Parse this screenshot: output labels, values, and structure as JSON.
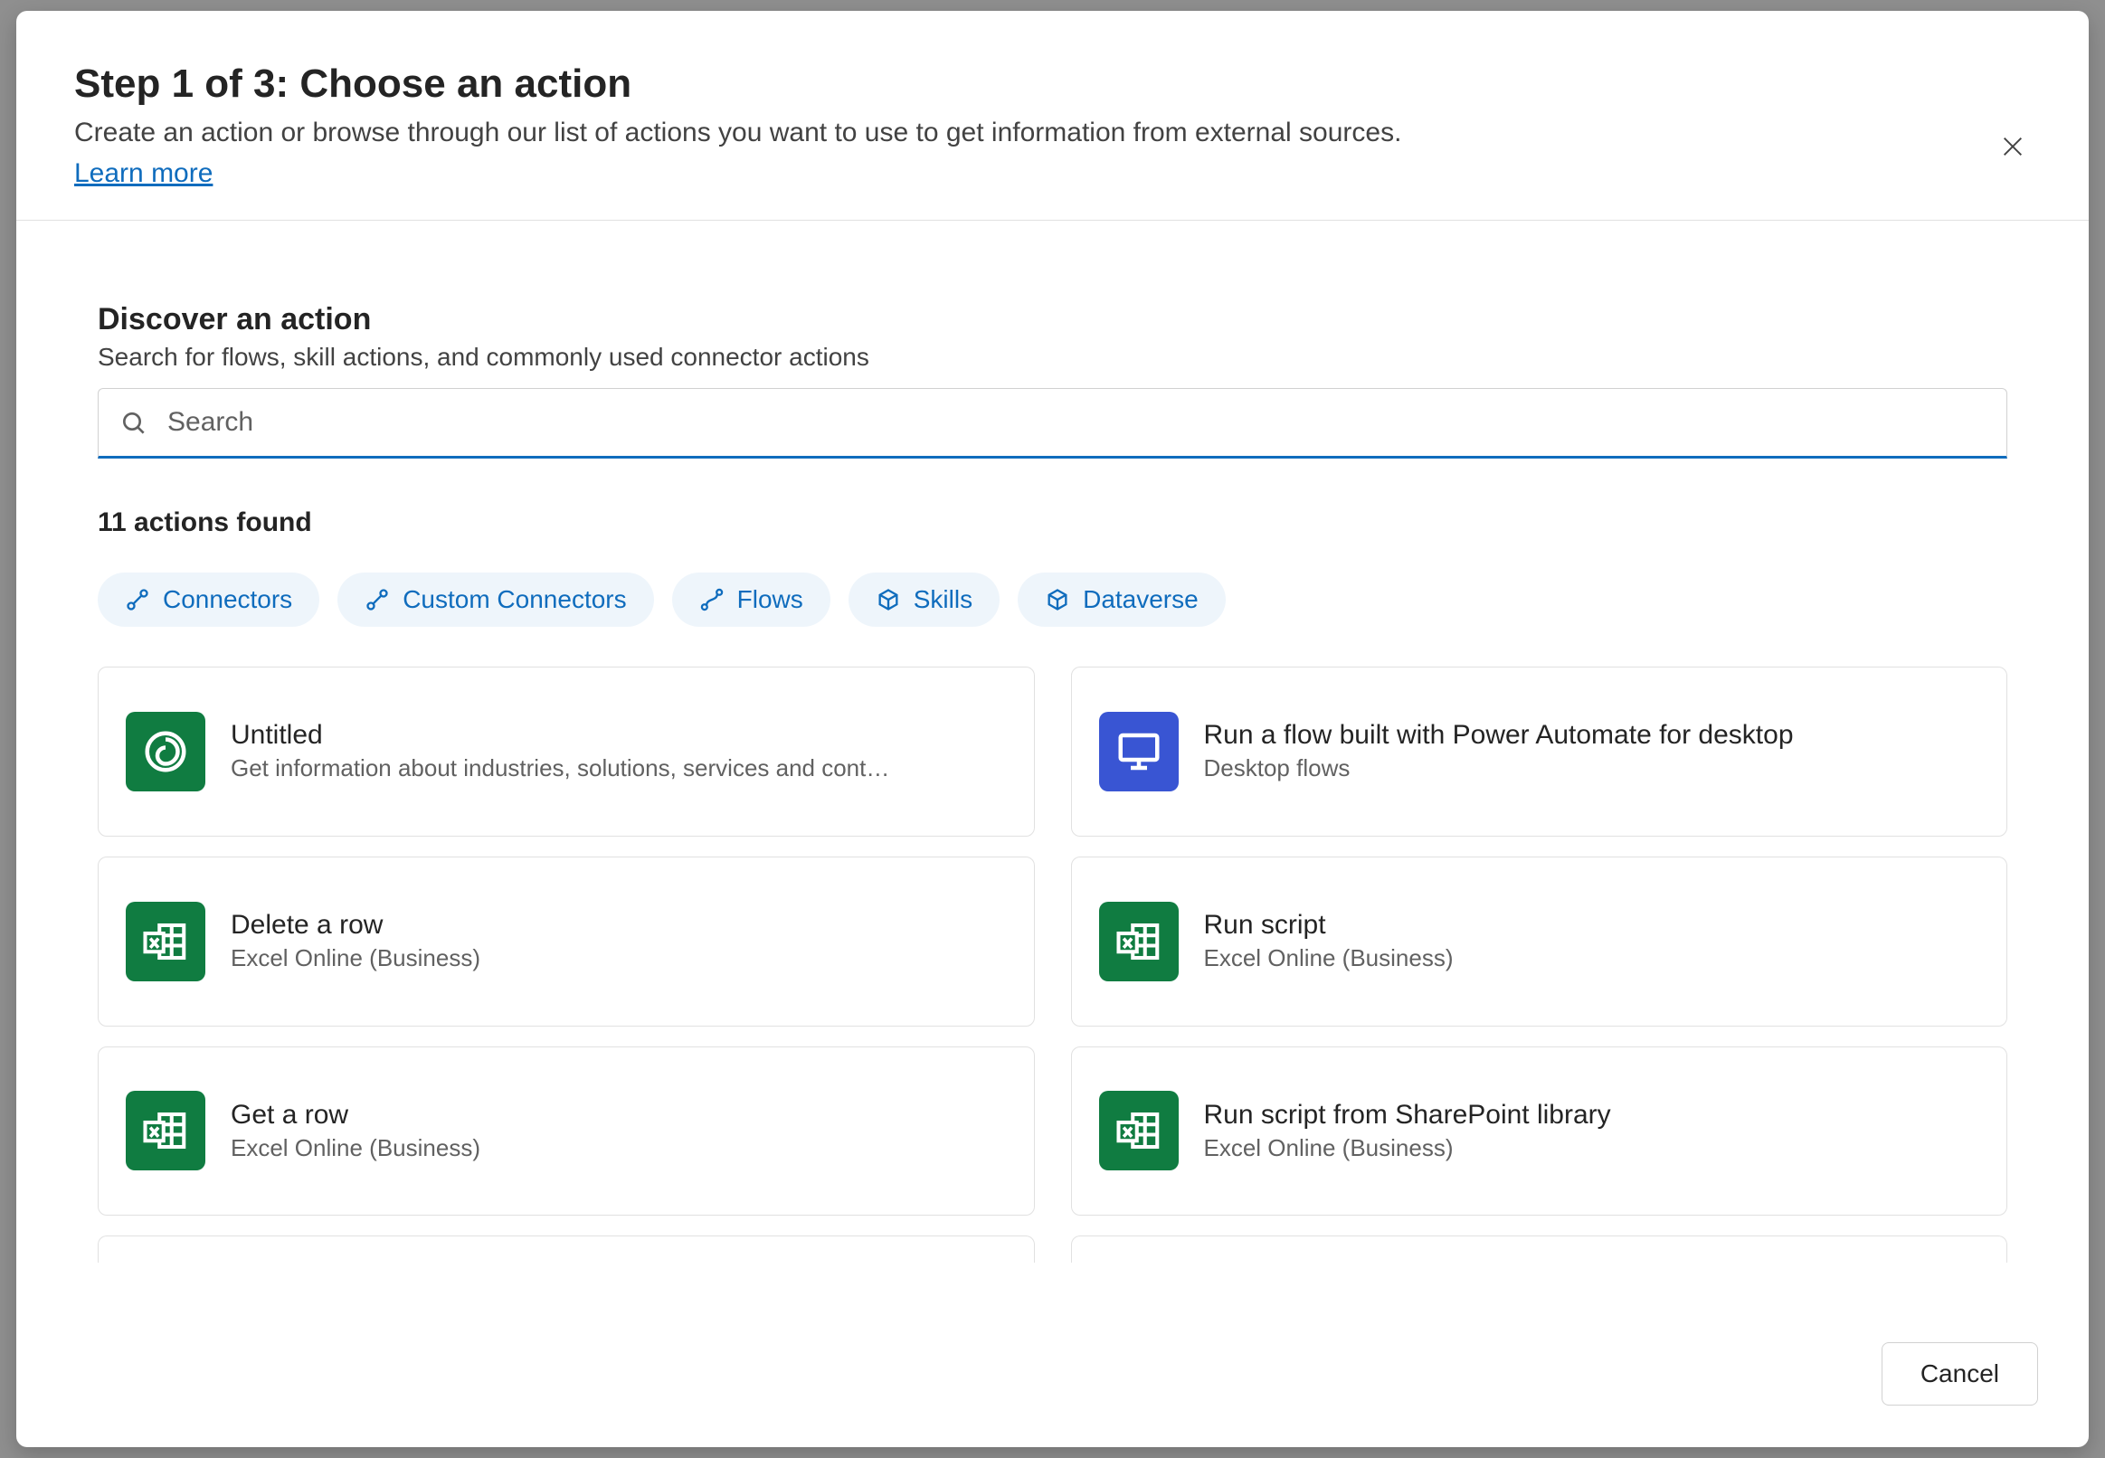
{
  "header": {
    "title": "Step 1 of 3: Choose an action",
    "subtitle": "Create an action or browse through our list of actions you want to use to get information from external sources.",
    "learn_more": "Learn more"
  },
  "discover": {
    "title": "Discover an action",
    "subtitle": "Search for flows, skill actions, and commonly used connector actions"
  },
  "search": {
    "placeholder": "Search",
    "value": ""
  },
  "results_count": "11 actions found",
  "filters": [
    {
      "label": "Connectors",
      "icon": "plug"
    },
    {
      "label": "Custom Connectors",
      "icon": "plug"
    },
    {
      "label": "Flows",
      "icon": "flow"
    },
    {
      "label": "Skills",
      "icon": "cube"
    },
    {
      "label": "Dataverse",
      "icon": "cube"
    }
  ],
  "actions": [
    {
      "title": "Untitled",
      "subtitle": "Get information about industries, solutions, services and cont…",
      "icon": "swirl",
      "icon_color": "green"
    },
    {
      "title": "Run a flow built with Power Automate for desktop",
      "subtitle": "Desktop flows",
      "icon": "desktop",
      "icon_color": "blue"
    },
    {
      "title": "Delete a row",
      "subtitle": "Excel Online (Business)",
      "icon": "excel",
      "icon_color": "green"
    },
    {
      "title": "Run script",
      "subtitle": "Excel Online (Business)",
      "icon": "excel",
      "icon_color": "green"
    },
    {
      "title": "Get a row",
      "subtitle": "Excel Online (Business)",
      "icon": "excel",
      "icon_color": "green"
    },
    {
      "title": "Run script from SharePoint library",
      "subtitle": "Excel Online (Business)",
      "icon": "excel",
      "icon_color": "green"
    }
  ],
  "footer": {
    "cancel": "Cancel"
  }
}
